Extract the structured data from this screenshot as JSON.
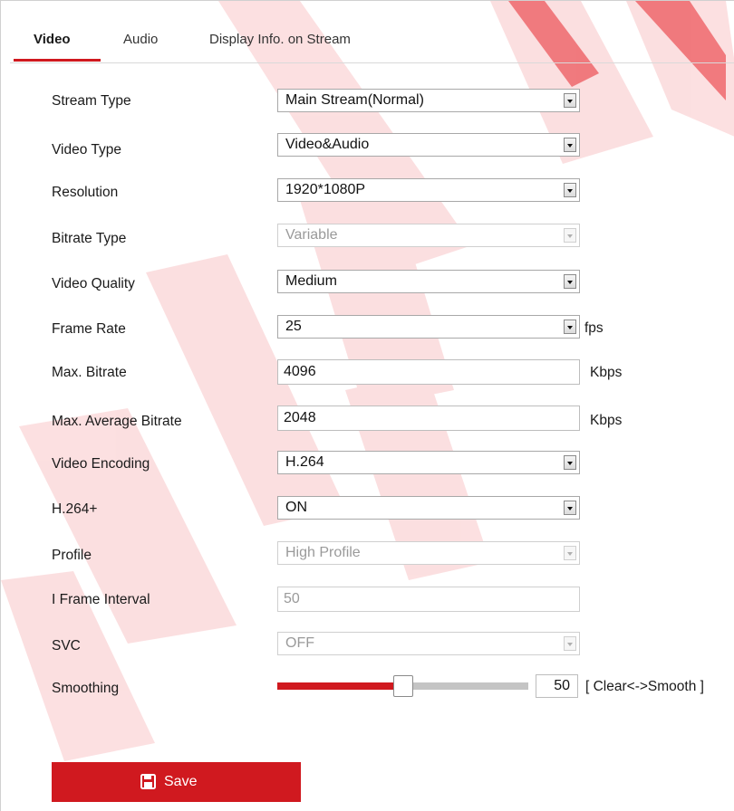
{
  "tabs": [
    {
      "label": "Video",
      "active": true
    },
    {
      "label": "Audio",
      "active": false
    },
    {
      "label": "Display Info. on Stream",
      "active": false
    }
  ],
  "fields": {
    "stream_type": {
      "label": "Stream Type",
      "value": "Main Stream(Normal)"
    },
    "video_type": {
      "label": "Video Type",
      "value": "Video&Audio"
    },
    "resolution": {
      "label": "Resolution",
      "value": "1920*1080P"
    },
    "bitrate_type": {
      "label": "Bitrate Type",
      "value": "Variable"
    },
    "video_quality": {
      "label": "Video Quality",
      "value": "Medium"
    },
    "frame_rate": {
      "label": "Frame Rate",
      "value": "25",
      "unit": "fps"
    },
    "max_bitrate": {
      "label": "Max. Bitrate",
      "value": "4096",
      "unit": "Kbps"
    },
    "max_avg_bitrate": {
      "label": "Max. Average Bitrate",
      "value": "2048",
      "unit": "Kbps"
    },
    "video_encoding": {
      "label": "Video Encoding",
      "value": "H.264"
    },
    "h264plus": {
      "label": "H.264+",
      "value": "ON"
    },
    "profile": {
      "label": "Profile",
      "value": "High Profile"
    },
    "i_frame_interval": {
      "label": "I Frame Interval",
      "value": "50"
    },
    "svc": {
      "label": "SVC",
      "value": "OFF"
    },
    "smoothing": {
      "label": "Smoothing",
      "value": "50",
      "level": 0.5,
      "hint": "[ Clear<->Smooth ]"
    }
  },
  "save": {
    "label": "Save"
  },
  "colors": {
    "accent": "#d0191f",
    "watermark": "#e8262d"
  },
  "icons": {
    "save": "floppy-disk-icon",
    "dropdown": "chevron-down-icon"
  }
}
